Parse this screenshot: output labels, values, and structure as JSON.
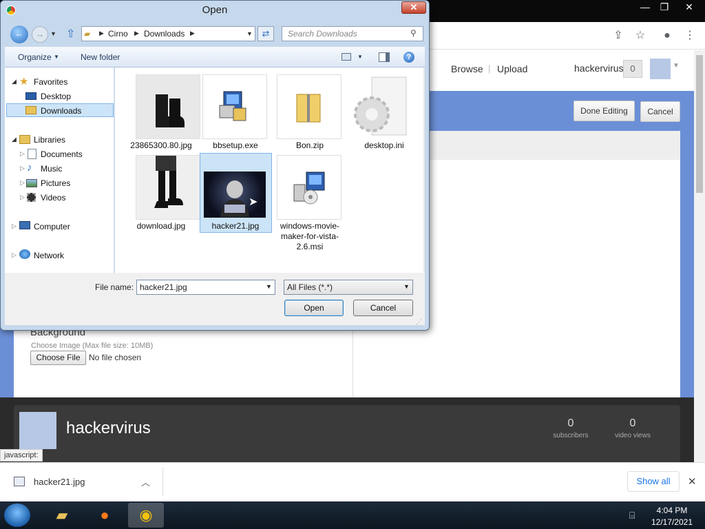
{
  "browser": {
    "tab_label": "javascript:",
    "toolbar_icons": [
      "share-icon",
      "star-icon",
      "profile-icon",
      "menu-icon"
    ]
  },
  "site": {
    "nav_browse": "Browse",
    "nav_upload": "Upload",
    "username": "hackervirus",
    "notif_count": "0",
    "done_editing": "Done Editing",
    "cancel": "Cancel",
    "background_heading": "Background",
    "choose_image_hint": "Choose Image (Max file size: 10MB)",
    "choose_file_btn": "Choose File",
    "no_file": "No file chosen",
    "channel_name": "hackervirus",
    "subscribers_count": "0",
    "subscribers_label": "subscribers",
    "views_count": "0",
    "views_label": "video views"
  },
  "dialog": {
    "title": "Open",
    "close_label": "✕",
    "breadcrumb": [
      "Cirno",
      "Downloads"
    ],
    "search_placeholder": "Search Downloads",
    "organize": "Organize",
    "new_folder": "New folder",
    "nav": {
      "favorites": "Favorites",
      "desktop": "Desktop",
      "downloads": "Downloads",
      "libraries": "Libraries",
      "documents": "Documents",
      "music": "Music",
      "pictures": "Pictures",
      "videos": "Videos",
      "computer": "Computer",
      "network": "Network"
    },
    "files": [
      {
        "name": "23865300.80.jpg"
      },
      {
        "name": "bbsetup.exe"
      },
      {
        "name": "Bon.zip"
      },
      {
        "name": "desktop.ini"
      },
      {
        "name": "download.jpg"
      },
      {
        "name": "hacker21.jpg"
      },
      {
        "name": "windows-movie-maker-for-vista-2.6.msi"
      }
    ],
    "file_name_label": "File name:",
    "file_name_value": "hacker21.jpg",
    "file_type": "All Files (*.*)",
    "open_btn": "Open",
    "cancel_btn": "Cancel"
  },
  "downloads_bar": {
    "item": "hacker21.jpg",
    "show_all": "Show all"
  },
  "taskbar": {
    "time": "4:04 PM",
    "date": "12/17/2021"
  }
}
